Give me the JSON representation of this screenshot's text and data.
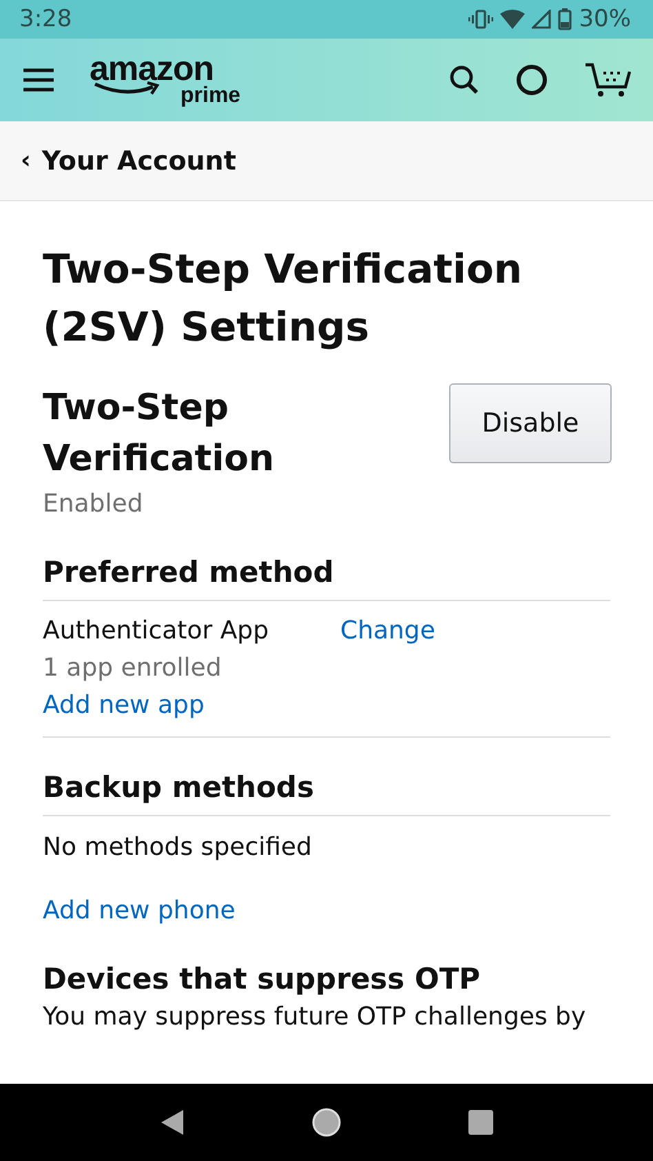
{
  "status_bar": {
    "time": "3:28",
    "battery": "30%"
  },
  "header": {
    "logo": "amazon",
    "logo_sub": "prime"
  },
  "breadcrumb": {
    "back": "‹",
    "label": "Your Account"
  },
  "page_title": "Two-Step Verification (2SV) Settings",
  "verification": {
    "title": "Two-Step Verification",
    "status": "Enabled",
    "button": "Disable"
  },
  "preferred": {
    "heading": "Preferred method",
    "method": "Authenticator App",
    "change": "Change",
    "detail": "1 app enrolled",
    "add": "Add new app"
  },
  "backup": {
    "heading": "Backup methods",
    "note": "No methods specified",
    "add": "Add new phone"
  },
  "otp": {
    "heading": "Devices that suppress OTP",
    "text": "You may suppress future OTP challenges by"
  }
}
